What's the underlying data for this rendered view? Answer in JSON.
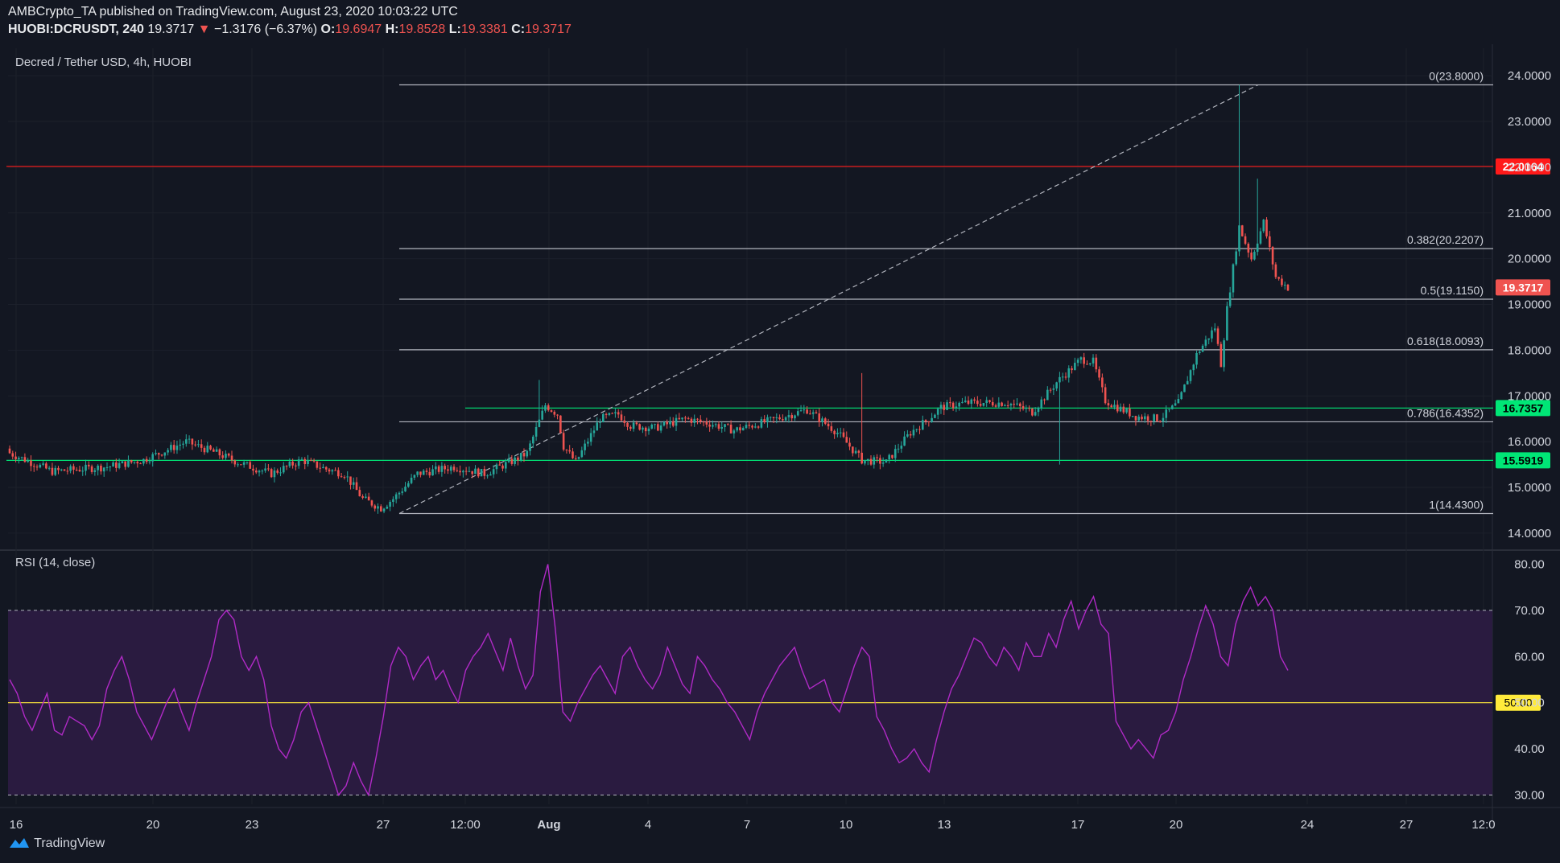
{
  "header": {
    "publisher_line": "AMBCrypto_TA published on TradingView.com, August 23, 2020 10:03:22 UTC",
    "symbol": "HUOBI:DCRUSDT, 240",
    "last": "19.3717",
    "change": "−1.3176 (−6.37%)",
    "o_label": "O:",
    "o": "19.6947",
    "h_label": "H:",
    "h": "19.8528",
    "l_label": "L:",
    "l": "19.3381",
    "c_label": "C:",
    "c": "19.3717"
  },
  "price_pane_title": "Decred / Tether USD, 4h, HUOBI",
  "rsi_pane_title": "RSI (14, close)",
  "footer_brand": "TradingView",
  "colors": {
    "bg": "#131722",
    "up": "#26a69a",
    "down": "#ef5350",
    "rsi": "#b02ac6",
    "rsi_band": "#2a1b40",
    "support": "#00e676",
    "resistance": "#ff1a1a",
    "midline": "#ffeb3b"
  },
  "chart_data": [
    {
      "type": "candlestick",
      "title": "Decred / Tether USD, 4h, HUOBI",
      "ylim": [
        13.7,
        24.6
      ],
      "y_ticks": [
        "14.0000",
        "15.0000",
        "16.0000",
        "17.0000",
        "18.0000",
        "19.0000",
        "20.0000",
        "21.0000",
        "22.0000",
        "23.0000",
        "24.0000"
      ],
      "x_ticks": [
        "16",
        "20",
        "23",
        "27",
        "12:00",
        "Aug",
        "4",
        "7",
        "10",
        "13",
        "17",
        "20",
        "24",
        "27",
        "12:0"
      ],
      "fib_levels": [
        {
          "label": "0(23.8000)",
          "value": 23.8
        },
        {
          "label": "0.382(20.2207)",
          "value": 20.2207
        },
        {
          "label": "0.5(19.1150)",
          "value": 19.115
        },
        {
          "label": "0.618(18.0093)",
          "value": 18.0093
        },
        {
          "label": "0.786(16.4352)",
          "value": 16.4352
        },
        {
          "label": "1(14.4300)",
          "value": 14.43
        }
      ],
      "horizontal_lines": [
        {
          "label": "22.0164",
          "value": 22.0164,
          "color": "#ff1a1a"
        },
        {
          "label": "16.7357",
          "value": 16.7357,
          "color": "#00e676"
        },
        {
          "label": "15.5919",
          "value": 15.5919,
          "color": "#00e676"
        }
      ],
      "last_price_label": "19.3717",
      "trend_line": {
        "from_date": "Jul 27",
        "from_value": 14.43,
        "to_date": "Aug 22",
        "to_value": 23.8
      },
      "ohlc_path": [
        [
          0,
          15.75
        ],
        [
          14,
          15.35
        ],
        [
          32,
          15.45
        ],
        [
          44,
          15.6
        ],
        [
          58,
          16.0
        ],
        [
          68,
          15.75
        ],
        [
          75,
          15.55
        ],
        [
          86,
          15.3
        ],
        [
          96,
          15.6
        ],
        [
          104,
          15.4
        ],
        [
          110,
          15.3
        ],
        [
          116,
          14.75
        ],
        [
          122,
          14.55
        ],
        [
          126,
          14.75
        ],
        [
          134,
          15.3
        ],
        [
          146,
          15.45
        ],
        [
          156,
          15.3
        ],
        [
          166,
          15.6
        ],
        [
          170,
          15.75
        ],
        [
          176,
          16.8
        ],
        [
          180,
          16.6
        ],
        [
          182,
          15.9
        ],
        [
          186,
          15.55
        ],
        [
          194,
          16.5
        ],
        [
          200,
          16.6
        ],
        [
          204,
          16.35
        ],
        [
          212,
          16.3
        ],
        [
          222,
          16.5
        ],
        [
          230,
          16.4
        ],
        [
          238,
          16.25
        ],
        [
          252,
          16.5
        ],
        [
          262,
          16.7
        ],
        [
          266,
          16.5
        ],
        [
          272,
          16.2
        ],
        [
          280,
          15.6
        ],
        [
          288,
          15.55
        ],
        [
          296,
          16.2
        ],
        [
          302,
          16.5
        ],
        [
          306,
          16.75
        ],
        [
          314,
          16.85
        ],
        [
          320,
          16.85
        ],
        [
          328,
          16.85
        ],
        [
          336,
          16.65
        ],
        [
          344,
          17.3
        ],
        [
          348,
          17.55
        ],
        [
          352,
          17.8
        ],
        [
          356,
          17.75
        ],
        [
          360,
          16.9
        ],
        [
          364,
          16.75
        ],
        [
          370,
          16.55
        ],
        [
          378,
          16.5
        ],
        [
          384,
          16.85
        ],
        [
          390,
          17.9
        ],
        [
          396,
          18.5
        ],
        [
          398,
          17.7
        ],
        [
          400,
          18.9
        ],
        [
          404,
          20.7
        ],
        [
          408,
          20.0
        ],
        [
          412,
          20.8
        ],
        [
          416,
          19.6
        ],
        [
          420,
          19.37
        ]
      ],
      "points_count": 421
    },
    {
      "type": "line",
      "title": "RSI (14, close)",
      "ylim": [
        28,
        82
      ],
      "y_ticks": [
        "30.00",
        "40.00",
        "50.00",
        "60.00",
        "70.00",
        "80.00"
      ],
      "bands": [
        30,
        70
      ],
      "midline": 50,
      "midline_label": "50.00",
      "series": [
        {
          "values": [
            55,
            52,
            47,
            44,
            48,
            52,
            44,
            43,
            47,
            46,
            45,
            42,
            45,
            53,
            57,
            60,
            55,
            48,
            45,
            42,
            46,
            50,
            53,
            48,
            44,
            50,
            55,
            60,
            68,
            70,
            68,
            60,
            57,
            60,
            55,
            45,
            40,
            38,
            42,
            48,
            50,
            45,
            40,
            35,
            30,
            32,
            37,
            33,
            30,
            38,
            47,
            58,
            62,
            60,
            55,
            58,
            60,
            55,
            57,
            53,
            50,
            57,
            60,
            62,
            65,
            61,
            57,
            64,
            58,
            53,
            56,
            74,
            80,
            66,
            48,
            46,
            50,
            53,
            56,
            58,
            55,
            52,
            60,
            62,
            58,
            55,
            53,
            56,
            62,
            58,
            54,
            52,
            60,
            58,
            55,
            53,
            50,
            48,
            45,
            42,
            48,
            52,
            55,
            58,
            60,
            62,
            57,
            53,
            54,
            55,
            50,
            48,
            53,
            58,
            62,
            60,
            47,
            44,
            40,
            37,
            38,
            40,
            37,
            35,
            42,
            48,
            53,
            56,
            60,
            64,
            63,
            60,
            58,
            62,
            60,
            57,
            63,
            60,
            60,
            65,
            62,
            68,
            72,
            66,
            70,
            73,
            67,
            65,
            46,
            43,
            40,
            42,
            40,
            38,
            43,
            44,
            48,
            55,
            60,
            66,
            71,
            67,
            60,
            58,
            67,
            72,
            75,
            71,
            73,
            70,
            60,
            57
          ]
        }
      ]
    }
  ]
}
